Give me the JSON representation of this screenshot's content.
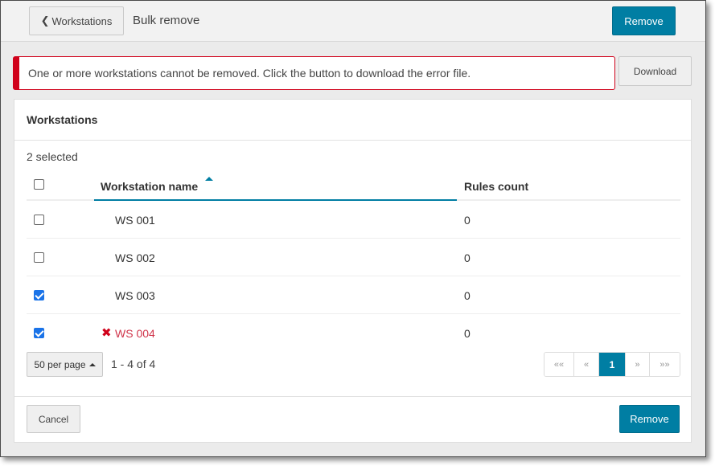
{
  "header": {
    "back_label": "Workstations",
    "back_icon": "chevron-left-icon",
    "title": "Bulk remove",
    "remove_label": "Remove"
  },
  "alert": {
    "message": "One or more workstations cannot be removed. Click the button to download the error file.",
    "download_label": "Download",
    "color": "#d0021b"
  },
  "panel": {
    "title": "Workstations",
    "selected_text": "2 selected",
    "columns": {
      "name": "Workstation name",
      "rules": "Rules count",
      "sort": "ascending"
    },
    "rows": [
      {
        "name": "WS 001",
        "rules": "0",
        "checked": false,
        "error": false
      },
      {
        "name": "WS 002",
        "rules": "0",
        "checked": false,
        "error": false
      },
      {
        "name": "WS 003",
        "rules": "0",
        "checked": true,
        "error": false
      },
      {
        "name": "WS 004",
        "rules": "0",
        "checked": true,
        "error": true
      }
    ],
    "per_page_label": "50 per page",
    "range_text": "1 - 4 of 4",
    "pagination": {
      "first": "««",
      "prev": "«",
      "current": "1",
      "next": "»",
      "last": "»»"
    },
    "cancel_label": "Cancel",
    "remove_label": "Remove"
  },
  "colors": {
    "primary": "#007ea3",
    "error": "#d0021b",
    "error_text": "#d0344a"
  }
}
